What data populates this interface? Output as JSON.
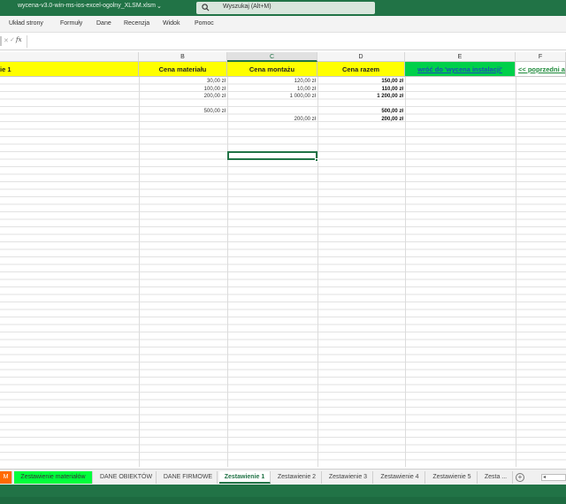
{
  "window": {
    "title": "wycena-v3.0-win-ms-ios-excel-ogolny_XLSM.xlsm",
    "title_caret": "⌄",
    "search_placeholder": "Wyszukaj (Alt+M)",
    "accent": "#217346"
  },
  "ribbon_tabs": [
    "Układ strony",
    "Formuły",
    "Dane",
    "Recenzja",
    "Widok",
    "Pomoc"
  ],
  "formula_bar": {
    "cancel_glyph": "✕",
    "enter_glyph": "✓",
    "fx_label": "fx",
    "value": ""
  },
  "columns": [
    {
      "letter": "B"
    },
    {
      "letter": "C"
    },
    {
      "letter": "D"
    },
    {
      "letter": "E"
    },
    {
      "letter": "F"
    }
  ],
  "header_row": {
    "a": "ie 1",
    "b": "Cena materiału",
    "c": "Cena montażu",
    "d": "Cena razem",
    "e": "wróć do 'wycena instalacji'",
    "f": "<< poprzedni ar"
  },
  "rows": [
    {
      "b": "30,00 zł",
      "c": "120,00 zł",
      "d": "150,00 zł"
    },
    {
      "b": "100,00 zł",
      "c": "10,00 zł",
      "d": "110,00 zł"
    },
    {
      "b": "200,00 zł",
      "c": "1 000,00 zł",
      "d": "1 200,00 zł"
    },
    {
      "b": "",
      "c": "",
      "d": ""
    },
    {
      "b": "500,00 zł",
      "c": "",
      "d": "500,00 zł"
    },
    {
      "b": "",
      "c": "200,00 zł",
      "d": "200,00 zł"
    }
  ],
  "sheet_tabs": [
    {
      "label": "M",
      "style": "orange"
    },
    {
      "label": "Zestawienie materiałów",
      "style": "green"
    },
    {
      "label": "DANE OBIEKTÓW",
      "style": "normal"
    },
    {
      "label": "DANE FIRMOWE",
      "style": "normal"
    },
    {
      "label": "Zestawienie 1",
      "style": "active"
    },
    {
      "label": "Zestawienie 2",
      "style": "normal"
    },
    {
      "label": "Zestawienie 3",
      "style": "normal"
    },
    {
      "label": "Zestawienie 4",
      "style": "normal"
    },
    {
      "label": "Zestawienie 5",
      "style": "normal"
    },
    {
      "label": "Zesta ...",
      "style": "normal"
    }
  ],
  "add_sheet_glyph": "+",
  "scroll_glyph": "◂",
  "colors": {
    "header_yellow": "#ffff00",
    "header_green": "#00d04a",
    "tab_orange": "#ff6a00",
    "tab_green": "#00ff3c"
  }
}
